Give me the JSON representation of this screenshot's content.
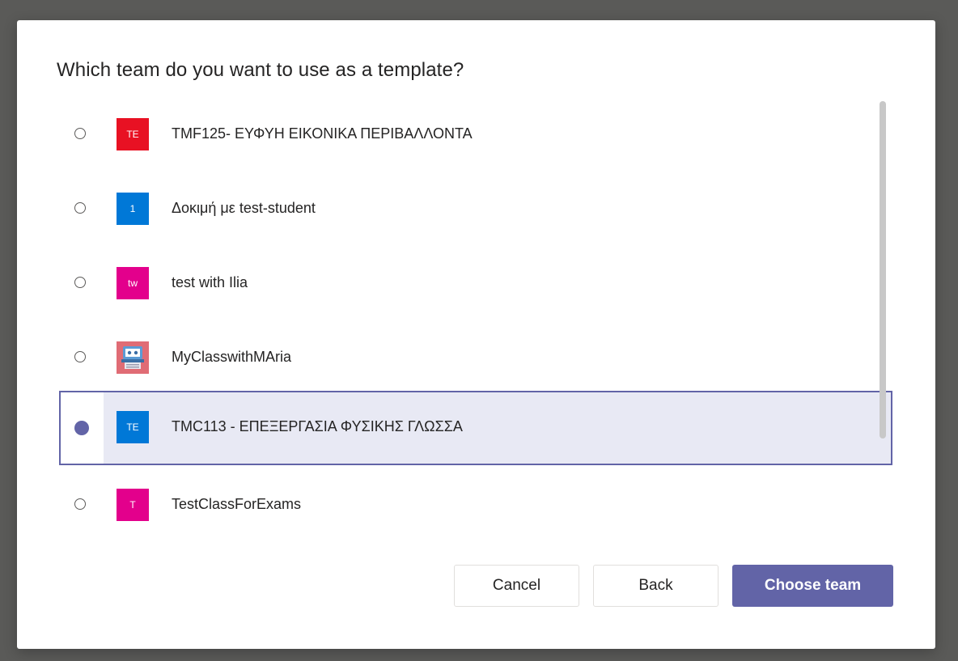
{
  "dialog": {
    "title": "Which team do you want to use as a template?"
  },
  "teams": [
    {
      "avatar_text": "TE",
      "avatar_color": "#e81123",
      "name": "TMF125- ΕΥΦΥΗ ΕΙΚΟΝΙΚΑ ΠΕΡΙΒΑΛΛΟΝΤΑ",
      "selected": false
    },
    {
      "avatar_text": "1",
      "avatar_color": "#0078d7",
      "name": "Δοκιμή με test-student",
      "selected": false
    },
    {
      "avatar_text": "tw",
      "avatar_color": "#e3008c",
      "name": "test with Ilia",
      "selected": false
    },
    {
      "avatar_text": "",
      "avatar_icon": "classroom-image-icon",
      "avatar_color": "#e06c75",
      "name": "MyClasswithMAria",
      "selected": false
    },
    {
      "avatar_text": "TE",
      "avatar_color": "#0078d7",
      "name": "TMC113 - ΕΠΕΞΕΡΓΑΣΙΑ ΦΥΣΙΚΗΣ ΓΛΩΣΣΑ",
      "selected": true
    },
    {
      "avatar_text": "T",
      "avatar_color": "#e3008c",
      "name": "TestClassForExams",
      "selected": false
    }
  ],
  "buttons": {
    "cancel_label": "Cancel",
    "back_label": "Back",
    "choose_label": "Choose team"
  },
  "colors": {
    "accent": "#6264a7",
    "selected_row_bg": "#e8e9f4"
  }
}
